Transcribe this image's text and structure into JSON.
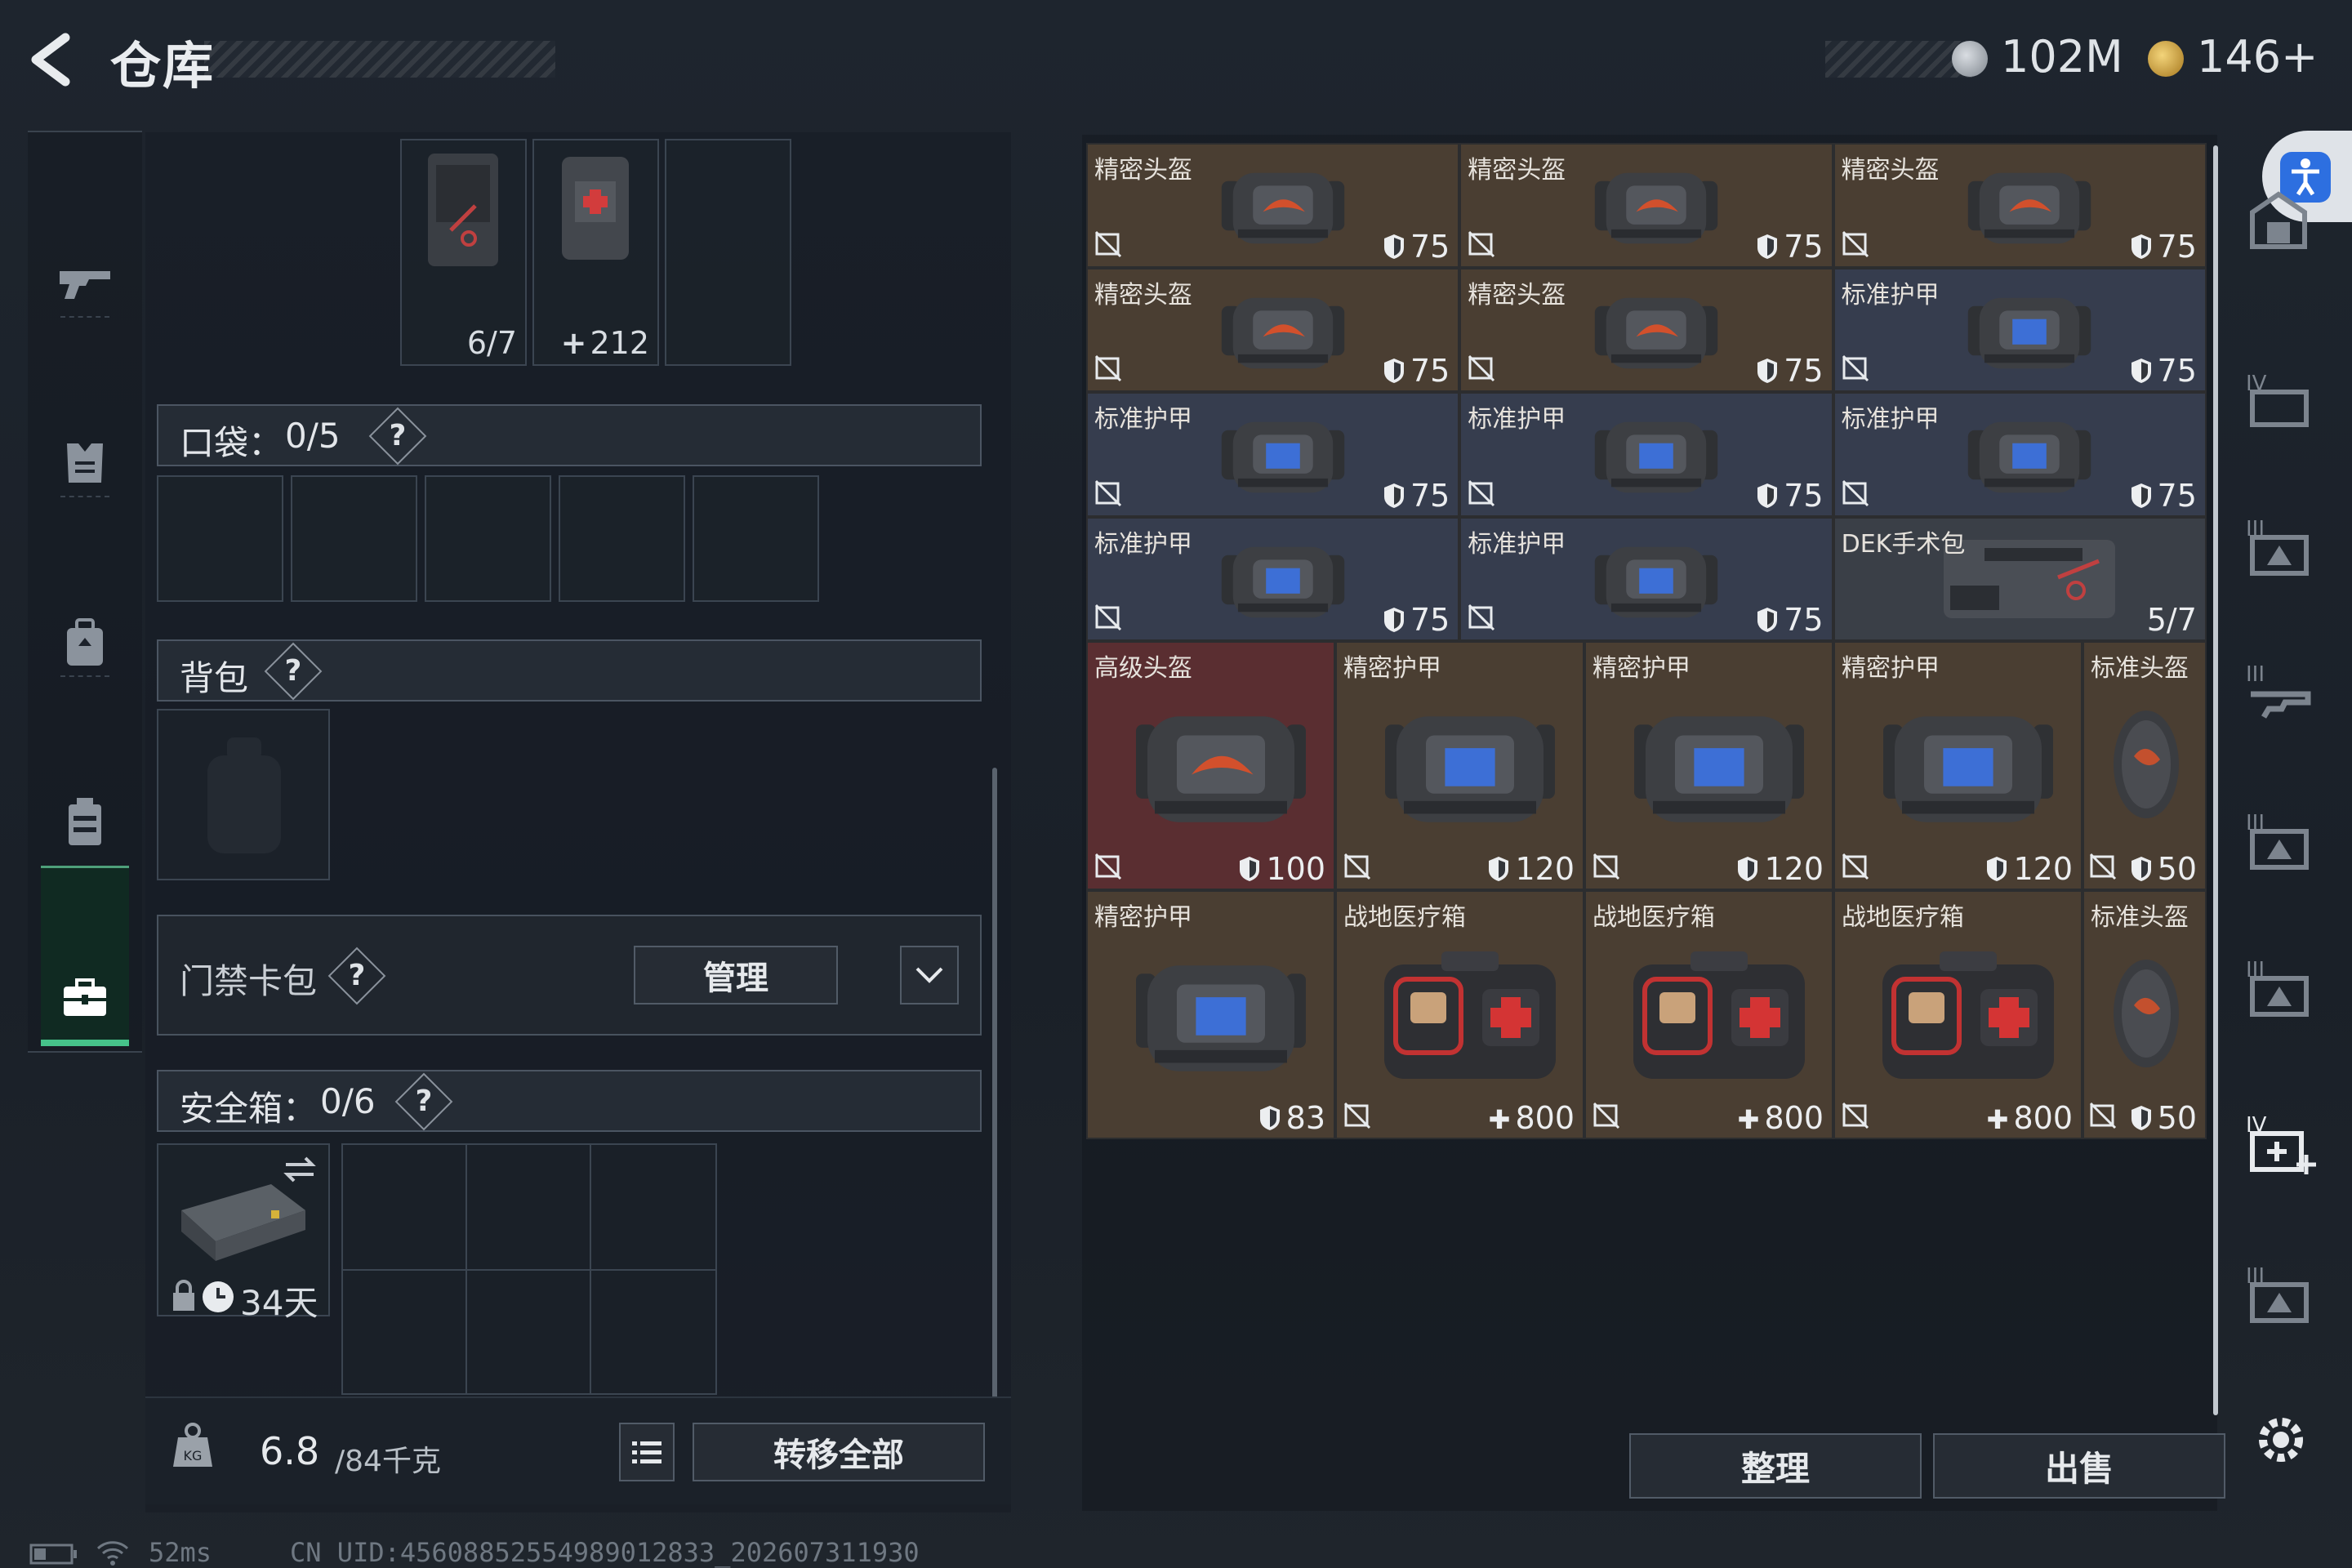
{
  "header": {
    "title": "仓库",
    "currency1_value": "102M",
    "currency2_value": "146+"
  },
  "left_nav": {
    "items": [
      "gun-icon",
      "armor-icon",
      "backpack-icon",
      "chest-rig-icon",
      "case-icon"
    ],
    "active_index": 4
  },
  "top_slots": [
    {
      "value": "6/7",
      "icon": "first-aid-pouch-icon"
    },
    {
      "value": "212",
      "icon": "medkit-pouch-icon",
      "prefix": "+"
    },
    {
      "value": "",
      "icon": ""
    }
  ],
  "pocket": {
    "label": "口袋：",
    "count": "0/5",
    "slots": 5
  },
  "backpack": {
    "label": "背包"
  },
  "keycard": {
    "label": "门禁卡包",
    "manage_button": "管理"
  },
  "safebox": {
    "label": "安全箱：",
    "count": "0/6",
    "days": "34天"
  },
  "bottom": {
    "weight": "6.8",
    "weight_max": "/84千克",
    "transfer_all": "转移全部"
  },
  "grid": {
    "items": [
      {
        "name": "精密头盔",
        "type": "helmet",
        "value": "75",
        "stat": "armor",
        "color": "brown"
      },
      {
        "name": "精密头盔",
        "type": "helmet",
        "value": "75",
        "stat": "armor",
        "color": "brown"
      },
      {
        "name": "精密头盔",
        "type": "helmet",
        "value": "75",
        "stat": "armor",
        "color": "brown"
      },
      {
        "name": "精密头盔",
        "type": "helmet",
        "value": "75",
        "stat": "armor",
        "color": "brown"
      },
      {
        "name": "精密头盔",
        "type": "helmet",
        "value": "75",
        "stat": "armor",
        "color": "brown"
      },
      {
        "name": "标准护甲",
        "type": "vest",
        "value": "75",
        "stat": "armor",
        "color": "blue"
      },
      {
        "name": "标准护甲",
        "type": "vest",
        "value": "75",
        "stat": "armor",
        "color": "blue"
      },
      {
        "name": "标准护甲",
        "type": "vest",
        "value": "75",
        "stat": "armor",
        "color": "blue"
      },
      {
        "name": "标准护甲",
        "type": "vest",
        "value": "75",
        "stat": "armor",
        "color": "blue"
      },
      {
        "name": "标准护甲",
        "type": "vest",
        "value": "75",
        "stat": "armor",
        "color": "blue"
      },
      {
        "name": "标准护甲",
        "type": "vest",
        "value": "75",
        "stat": "armor",
        "color": "blue"
      },
      {
        "name": "DEK手术包",
        "type": "surgical",
        "value": "5/7",
        "stat": "uses",
        "color": "gray"
      },
      {
        "name": "高级头盔",
        "type": "helmet-large",
        "value": "100",
        "stat": "armor",
        "color": "red"
      },
      {
        "name": "精密护甲",
        "type": "vest-large",
        "value": "120",
        "stat": "armor",
        "color": "brown"
      },
      {
        "name": "精密护甲",
        "type": "vest-large",
        "value": "120",
        "stat": "armor",
        "color": "brown"
      },
      {
        "name": "精密护甲",
        "type": "vest-large",
        "value": "120",
        "stat": "armor",
        "color": "brown"
      },
      {
        "name": "标准头盔",
        "type": "helmet-tall",
        "value": "50",
        "stat": "armor",
        "color": "brown"
      },
      {
        "name": "精密护甲",
        "type": "vest-large",
        "value": "83",
        "stat": "armor",
        "color": "brown"
      },
      {
        "name": "战地医疗箱",
        "type": "medkit",
        "value": "800",
        "stat": "heal",
        "color": "brown"
      },
      {
        "name": "战地医疗箱",
        "type": "medkit",
        "value": "800",
        "stat": "heal",
        "color": "brown"
      },
      {
        "name": "战地医疗箱",
        "type": "medkit",
        "value": "800",
        "stat": "heal",
        "color": "brown"
      },
      {
        "name": "标准头盔",
        "type": "helmet-tall",
        "value": "50",
        "stat": "armor",
        "color": "brown"
      }
    ]
  },
  "actions": {
    "sort": "整理",
    "sell": "出售"
  },
  "status": {
    "ping": "52ms",
    "uid": "CN UID:4560885255498901283​3_202607311930"
  },
  "colors": {
    "accent_green": "#46c28a",
    "cell_brown": "#4a3e32",
    "cell_blue": "#363d4e",
    "cell_red": "#5a2e31",
    "accessibility_blue": "#2d6fe0"
  }
}
